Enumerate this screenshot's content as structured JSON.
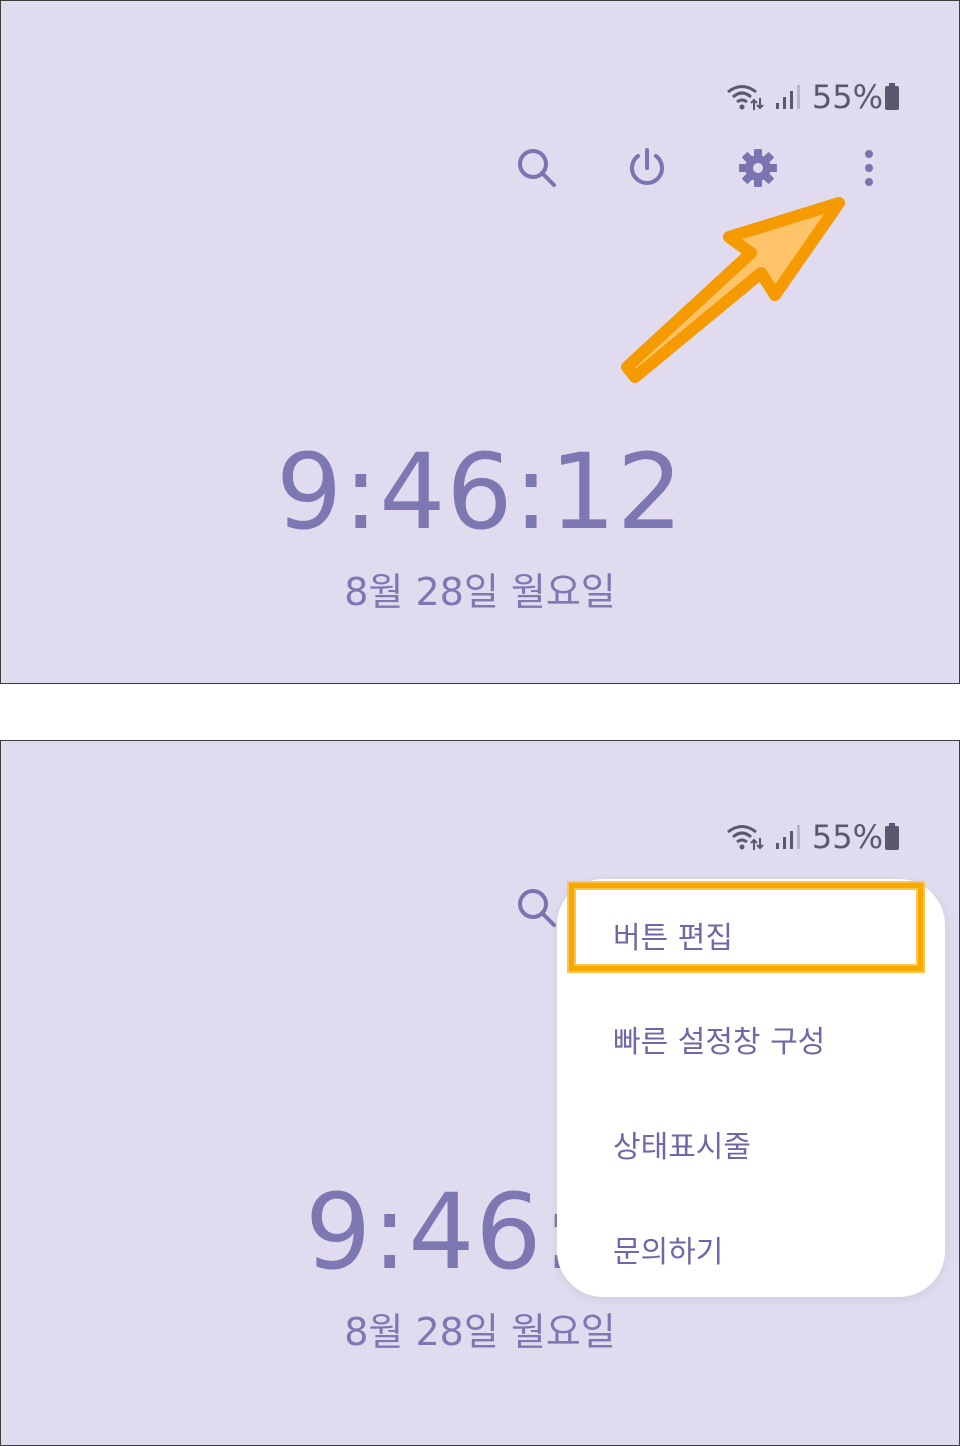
{
  "status_bar": {
    "battery_percent": "55%",
    "icons": [
      "wifi-icon",
      "signal-icon",
      "battery-icon"
    ]
  },
  "toolbar": {
    "icons": [
      "search-icon",
      "power-icon",
      "settings-icon",
      "more-options-icon"
    ]
  },
  "clock": {
    "time": "9:46:12",
    "time_partial": "9:46:1",
    "date": "8월 28일 월요일"
  },
  "menu": {
    "items": [
      {
        "label": "버튼 편집"
      },
      {
        "label": "빠른 설정창 구성"
      },
      {
        "label": "상태표시줄"
      },
      {
        "label": "문의하기"
      }
    ]
  },
  "colors": {
    "background": "#e1dbf0",
    "accent_text": "#7e78b2",
    "icon": "#7a74b0",
    "highlight": "#f8a800"
  }
}
